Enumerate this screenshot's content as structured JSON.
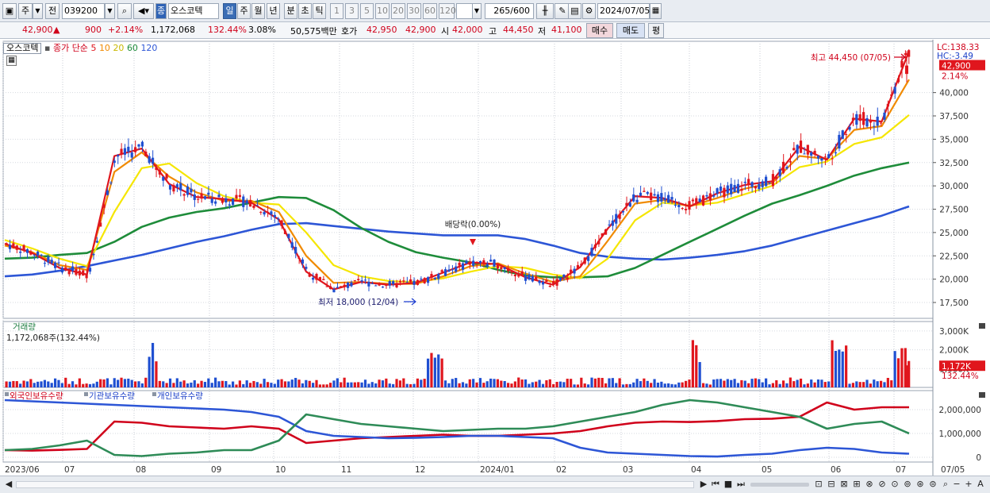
{
  "toolbar": {
    "chart_type": "주",
    "prev_label": "전",
    "stock_code": "039200",
    "market_badge": "종",
    "stock_name": "오스코텍",
    "period_tabs": [
      "일",
      "주",
      "월",
      "년",
      "분",
      "초",
      "틱"
    ],
    "period_selected": "일",
    "interval_options": [
      "1",
      "3",
      "5",
      "10",
      "20",
      "30",
      "60",
      "120"
    ],
    "count_display": "265",
    "count_max": "/600",
    "date": "2024/07/05"
  },
  "info": {
    "price": "42,900",
    "arrow": "▲",
    "change": "900",
    "change_pct": "+2.14%",
    "volume": "1,172,068",
    "volume_ratio": "132.44%",
    "turnover": "3.08%",
    "amount": "50,575백만",
    "quote_label": "호가",
    "ask": "42,950",
    "bid": "42,900",
    "open_label": "시",
    "open": "42,000",
    "high_label": "고",
    "high": "44,450",
    "low_label": "저",
    "low": "41,100",
    "buy_button": "매수",
    "sell_button": "매도",
    "eval_button": "평"
  },
  "price_panel": {
    "stock_tag": "오스코텍",
    "ma_title": "종가 단순",
    "ma_periods": [
      "5",
      "10",
      "20",
      "60",
      "120"
    ],
    "ma_colors": [
      "#e0161d",
      "#f08a00",
      "#f5e600",
      "#1e8c3a",
      "#2d56d6"
    ],
    "lc_label": "LC:138.33",
    "hc_label": "HC:-3.49",
    "current_price_label": "42,900",
    "current_pct_label": "2.14%",
    "high_annotation": "최고 44,450 (07/05)",
    "low_annotation": "최저 18,000 (12/04)",
    "dividend_annotation": "배당락(0.00%)",
    "y_ticks": [
      "40,000",
      "37,500",
      "35,000",
      "32,500",
      "30,000",
      "27,500",
      "25,000",
      "22,500",
      "20,000",
      "17,500"
    ]
  },
  "volume_panel": {
    "title": "거래량",
    "value_label": "1,172,068주(132.44%)",
    "y_ticks": [
      "3,000K",
      "2,000K",
      "1,000K"
    ],
    "current_label": "1,172K",
    "current_pct": "132.44%"
  },
  "holding_panel": {
    "legend": [
      "외국인보유수량",
      "기관보유수량",
      "개인보유수량"
    ],
    "legend_colors": [
      "#d0021b",
      "#2d56d6",
      "#2e8b57"
    ],
    "y_ticks": [
      "2,000,000",
      "1,000,000",
      "0"
    ]
  },
  "x_axis": [
    "2023/06",
    "07",
    "08",
    "09",
    "10",
    "11",
    "12",
    "2024/01",
    "02",
    "03",
    "04",
    "05",
    "06",
    "07"
  ],
  "x_axis_right": "07/05",
  "chart_data": {
    "type": "candlestick",
    "x_start": "2023/06",
    "x_end": "2024/07/05",
    "series": [
      {
        "name": "5",
        "values": [
          23800,
          22800,
          21200,
          20500,
          33200,
          34000,
          30200,
          28800,
          28600,
          28200,
          26400,
          20800,
          18900,
          19700,
          19400,
          19600,
          20700,
          21800,
          21600,
          20200,
          19400,
          21300,
          25400,
          28900,
          28700,
          27800,
          29200,
          30100,
          30500,
          34200,
          32800,
          37200,
          36900,
          44450
        ]
      },
      {
        "name": "10",
        "values": [
          23600,
          22900,
          21500,
          21000,
          31500,
          33600,
          31000,
          29300,
          28400,
          28400,
          27200,
          22500,
          19600,
          19700,
          19500,
          19500,
          20300,
          21400,
          21700,
          20600,
          19700,
          20300,
          24100,
          28100,
          28500,
          27800,
          28700,
          29700,
          30300,
          33200,
          32900,
          36000,
          36400,
          41400
        ]
      },
      {
        "name": "20",
        "values": [
          24200,
          23300,
          22200,
          21400,
          27200,
          31900,
          32400,
          30300,
          28900,
          28200,
          28000,
          25000,
          21500,
          20300,
          19800,
          19700,
          20100,
          20800,
          21400,
          21200,
          20500,
          20100,
          22200,
          26300,
          28200,
          27900,
          28200,
          29100,
          30000,
          32000,
          32600,
          34500,
          35200,
          37600
        ]
      },
      {
        "name": "60",
        "values": [
          22200,
          22300,
          22600,
          22800,
          24000,
          25600,
          26600,
          27200,
          27600,
          28200,
          28800,
          28700,
          27400,
          25500,
          24000,
          22900,
          22300,
          21800,
          21000,
          20400,
          20200,
          20200,
          20300,
          21200,
          22600,
          24000,
          25400,
          26800,
          28100,
          29000,
          30000,
          31100,
          31900,
          32500
        ]
      },
      {
        "name": "120",
        "values": [
          20300,
          20500,
          20900,
          21400,
          22000,
          22600,
          23300,
          24000,
          24600,
          25300,
          25900,
          26000,
          25700,
          25400,
          25100,
          24900,
          24700,
          24700,
          24700,
          24300,
          23600,
          22800,
          22400,
          22200,
          22100,
          22300,
          22600,
          23000,
          23600,
          24400,
          25200,
          26000,
          26800,
          27800
        ]
      }
    ],
    "ohlc_anchors": [
      {
        "date": "2024/07/05",
        "open": 42000,
        "high": 44450,
        "low": 41100,
        "close": 42900
      },
      {
        "date": "2023/12/04",
        "low": 18000
      }
    ],
    "volume_current": 1172068,
    "holding": [
      {
        "name": "외국인보유수량",
        "values": [
          300000,
          280000,
          310000,
          350000,
          1500000,
          1450000,
          1300000,
          1250000,
          1200000,
          1300000,
          1200000,
          600000,
          700000,
          800000,
          850000,
          900000,
          950000,
          900000,
          900000,
          950000,
          1000000,
          1100000,
          1300000,
          1450000,
          1500000,
          1480000,
          1520000,
          1600000,
          1620000,
          1700000,
          2300000,
          2000000,
          2100000,
          2100000
        ]
      },
      {
        "name": "기관보유수량",
        "values": [
          2400000,
          2350000,
          2300000,
          2250000,
          2200000,
          2150000,
          2100000,
          2050000,
          2000000,
          1900000,
          1700000,
          1100000,
          900000,
          850000,
          800000,
          820000,
          850000,
          900000,
          900000,
          850000,
          800000,
          400000,
          200000,
          150000,
          100000,
          50000,
          30000,
          100000,
          150000,
          300000,
          400000,
          350000,
          200000,
          150000
        ]
      },
      {
        "name": "개인보유수량",
        "values": [
          300000,
          350000,
          500000,
          700000,
          100000,
          50000,
          150000,
          200000,
          300000,
          300000,
          700000,
          1800000,
          1600000,
          1400000,
          1300000,
          1200000,
          1100000,
          1150000,
          1200000,
          1200000,
          1300000,
          1500000,
          1700000,
          1900000,
          2200000,
          2400000,
          2300000,
          2100000,
          1900000,
          1700000,
          1200000,
          1400000,
          1500000,
          1000000
        ]
      }
    ]
  }
}
